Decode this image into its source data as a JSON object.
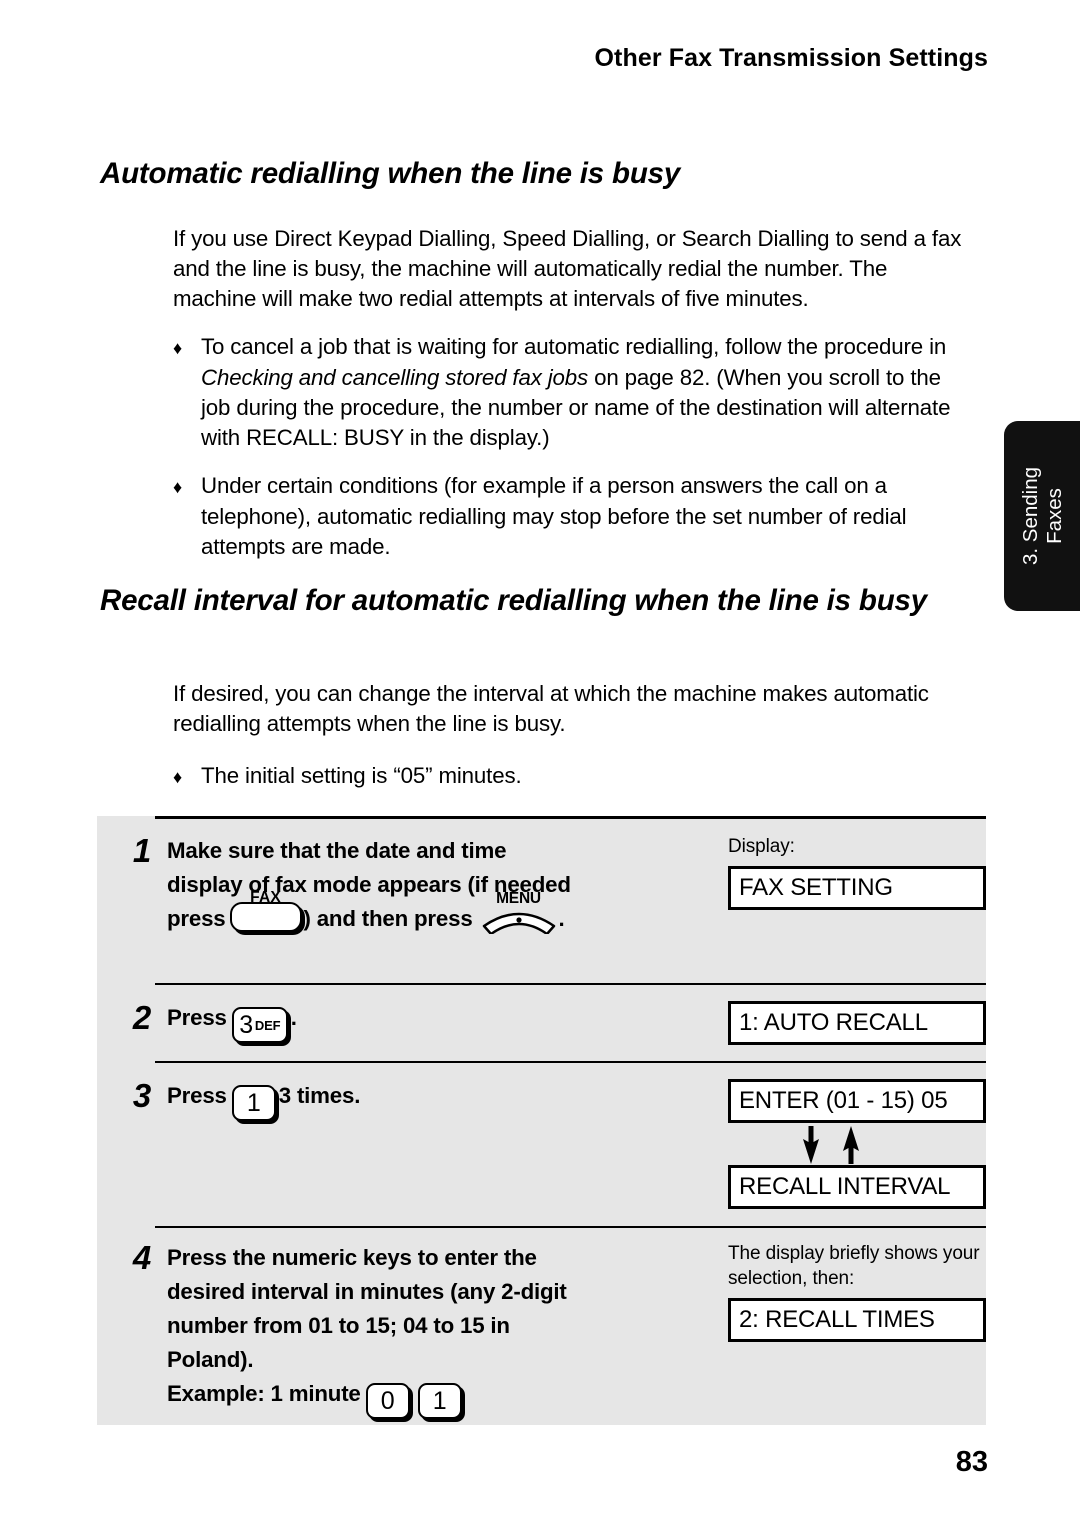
{
  "running_header": "Other Fax Transmission Settings",
  "page_number": "83",
  "side_tab": {
    "line1": "3. Sending",
    "line2": "Faxes"
  },
  "sections": {
    "automatic_redialling": {
      "heading": "Automatic redialling when the line is busy",
      "intro": "If you use Direct Keypad Dialling, Speed Dialling, or Search Dialling to send a fax and the line is busy, the machine will automatically redial the number. The machine will make two redial attempts at intervals of five minutes.",
      "bullet_marker": "♦",
      "bullet_cancel_part1": "To cancel a job that is waiting for automatic redialling, follow the procedure in ",
      "bullet_cancel_italic": "Checking and cancelling stored fax jobs",
      "bullet_cancel_part2": " on page 82. (When you scroll to the job during the procedure, the number or name of the destination will alternate with RECALL: BUSY in the display.)",
      "bullet_conditions": "Under certain conditions (for example if a person answers the call on a telephone), automatic redialling may stop before the set number of redial attempts are made."
    },
    "recall_interval": {
      "heading": "Recall interval for automatic redialling when the line is busy",
      "intro": "If desired, you can change the interval at which the machine makes automatic redialling attempts when the line is busy.",
      "bullet_initial": "The initial setting is “05” minutes."
    }
  },
  "procedure": {
    "display_label": "Display:",
    "steps": [
      {
        "number": "1",
        "line1": "Make sure that the date and time",
        "line2": "display of fax mode appears (if needed",
        "line3_pre": "press",
        "line3_mid": ") and then press",
        "line3_post": ".",
        "key_fax_label": "FAX",
        "key_menu_label": "MENU",
        "display_value": "FAX SETTING"
      },
      {
        "number": "2",
        "line1_pre": "Press",
        "key_digit": "3",
        "key_letters": "DEF",
        "line1_post": ".",
        "display_value": "1: AUTO RECALL"
      },
      {
        "number": "3",
        "line1_pre": "Press",
        "key_digit": "1",
        "line1_post": "3 times.",
        "display_value": "ENTER (01 - 15) 05",
        "display_value_alt": "RECALL INTERVAL"
      },
      {
        "number": "4",
        "line1": "Press the numeric keys to enter the",
        "line2": "desired interval in minutes (any 2-digit",
        "line3": "number from 01 to 15; 04 to 15 in",
        "line4": "Poland).",
        "example_label": "Example: 1 minute",
        "key_digit_1": "0",
        "key_digit_2": "1",
        "display_note": "The display briefly shows your selection, then:",
        "display_value": "2: RECALL TIMES"
      }
    ]
  },
  "colors": {
    "panel_bg": "#e6e6e6",
    "tab_bg": "#111111",
    "lcd_bg": "#ffffff",
    "ink": "#000000"
  }
}
